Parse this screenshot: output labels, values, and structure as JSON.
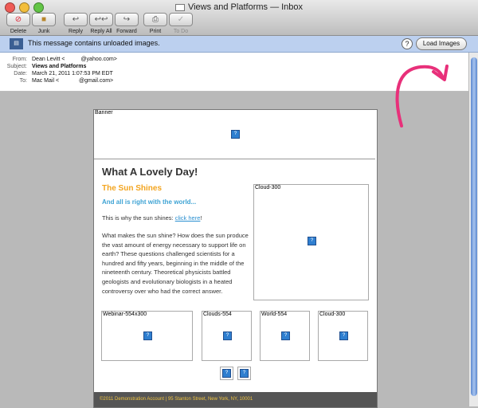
{
  "window": {
    "title": "Views and Platforms — Inbox"
  },
  "toolbar": {
    "delete": "Delete",
    "junk": "Junk",
    "reply": "Reply",
    "reply_all": "Reply All",
    "forward": "Forward",
    "print": "Print",
    "todo": "To Do"
  },
  "notice": {
    "text": "This message contains unloaded images.",
    "help": "?",
    "load_button": "Load Images"
  },
  "headers": {
    "from_label": "From:",
    "from_name": "Dean Levitt <",
    "from_addr": "@yahoo.com>",
    "subject_label": "Subject:",
    "subject": "Views and Platforms",
    "date_label": "Date:",
    "date": "March 21, 2011 1:07:53 PM EDT",
    "to_label": "To:",
    "to_name": "Mac Mail <",
    "to_addr": "@gmail.com>"
  },
  "email": {
    "banner_alt": "Banner",
    "headline": "What A Lovely Day!",
    "subhead": "The Sun Shines",
    "tagline": "And all is right with the world...",
    "link_prefix": "This is why the sun shines: ",
    "link_text": "click here",
    "link_suffix": "!",
    "body": "What makes the sun shine? How does the sun produce the vast amount of energy necessary to support life on earth? These questions challenged scientists for a hundred and fifty years, beginning in the middle of the nineteenth century. Theoretical physicists battled geologists and evolutionary biologists in a heated controversy over who had the correct answer.",
    "cloud_alt": "Cloud-300",
    "thumbs": [
      "Webinar-554x300",
      "Clouds-554",
      "World-554",
      "Cloud-300"
    ],
    "footer": "©2011 Demonstration Account | 95 Stanton Street, New York, NY, 10001"
  },
  "colors": {
    "accent_orange": "#f3a520",
    "accent_blue": "#3ea3d4",
    "annotation": "#e8307a"
  }
}
